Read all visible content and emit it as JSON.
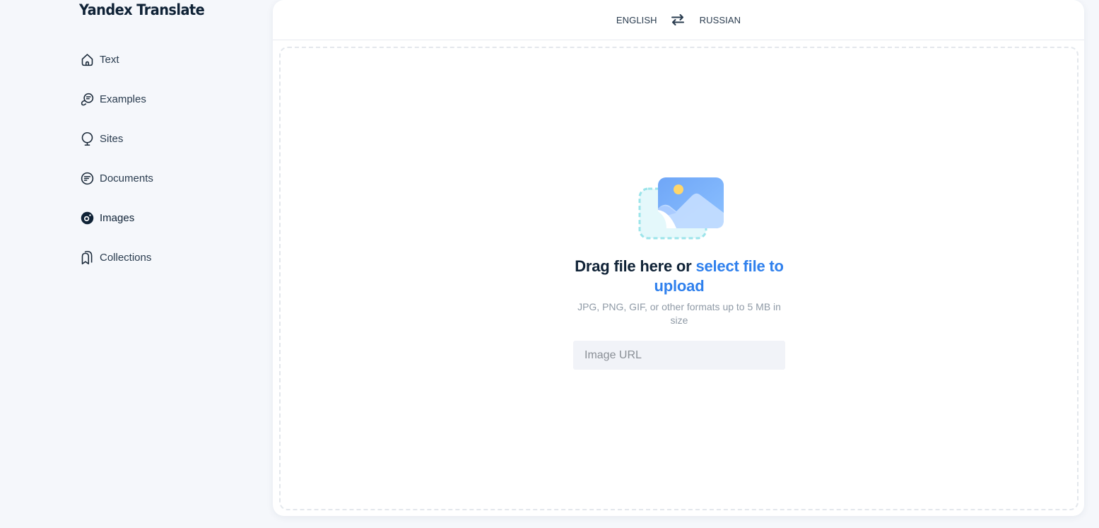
{
  "app": {
    "title": "Yandex Translate"
  },
  "sidebar": {
    "items": [
      {
        "label": "Text",
        "icon": "home-icon",
        "active": false
      },
      {
        "label": "Examples",
        "icon": "chat-bubble-icon",
        "active": false
      },
      {
        "label": "Sites",
        "icon": "globe-icon",
        "active": false
      },
      {
        "label": "Documents",
        "icon": "document-icon",
        "active": false
      },
      {
        "label": "Images",
        "icon": "camera-icon",
        "active": true
      },
      {
        "label": "Collections",
        "icon": "bookmark-icon",
        "active": false
      }
    ]
  },
  "languages": {
    "source": "ENGLISH",
    "target": "RUSSIAN",
    "swap_icon": "swap-arrows-icon"
  },
  "upload": {
    "title_prefix": "Drag file here or ",
    "title_link": "select file to upload",
    "hint": "JPG, PNG, GIF, or other formats up to 5 MB in size",
    "url_placeholder": "Image URL",
    "url_value": ""
  },
  "colors": {
    "accent": "#2f80ed",
    "text_dark": "#0f2236",
    "background": "#f5f7fb"
  }
}
